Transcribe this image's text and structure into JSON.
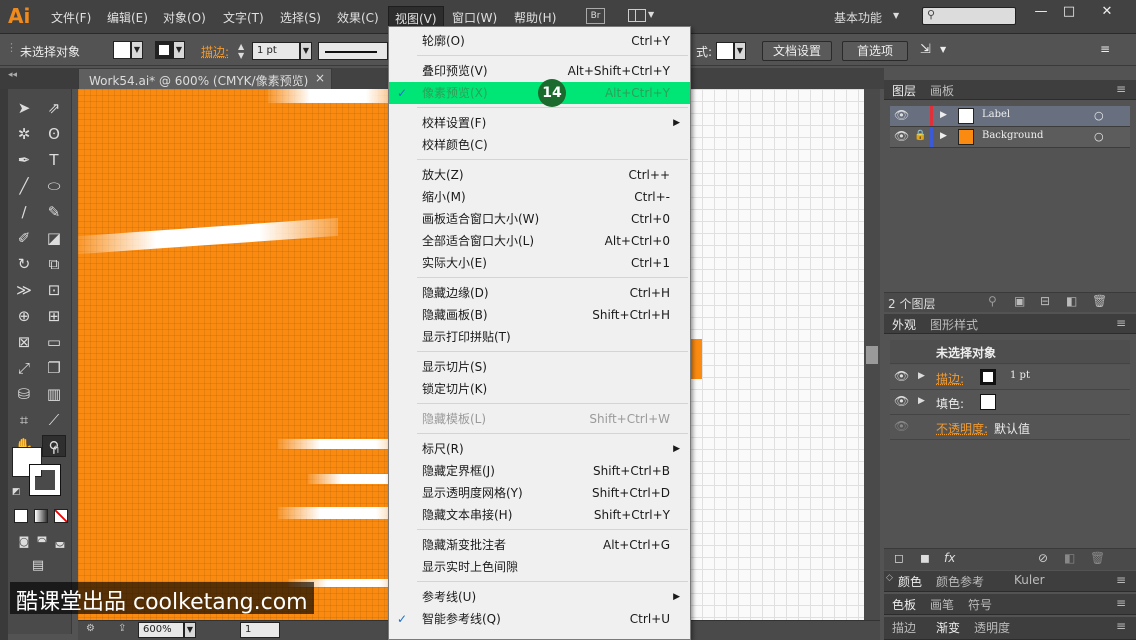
{
  "menubar": {
    "items": [
      "文件(F)",
      "编辑(E)",
      "对象(O)",
      "文字(T)",
      "选择(S)",
      "效果(C)",
      "视图(V)",
      "窗口(W)",
      "帮助(H)"
    ],
    "active_item": "视图(V)",
    "bridge_label": "Br",
    "workspace": "基本功能",
    "search_placeholder": ""
  },
  "control_bar": {
    "selection_status": "未选择对象",
    "stroke_label": "描边:",
    "stroke_weight": "1 pt",
    "style_label": "式:",
    "document_setup_button": "文档设置",
    "preferences_button": "首选项"
  },
  "document_tab": {
    "title": "Work54.ai* @ 600% (CMYK/像素预览)",
    "close": "×"
  },
  "view_menu": {
    "groups": [
      [
        {
          "label": "轮廓(O)",
          "shortcut": "Ctrl+Y"
        }
      ],
      [
        {
          "label": "叠印预览(V)",
          "shortcut": "Alt+Shift+Ctrl+Y"
        },
        {
          "label": "像素预览(X)",
          "shortcut": "Alt+Ctrl+Y",
          "checked": true,
          "highlighted": true
        }
      ],
      [
        {
          "label": "校样设置(F)",
          "submenu": true
        },
        {
          "label": "校样颜色(C)"
        }
      ],
      [
        {
          "label": "放大(Z)",
          "shortcut": "Ctrl++"
        },
        {
          "label": "缩小(M)",
          "shortcut": "Ctrl+-"
        },
        {
          "label": "画板适合窗口大小(W)",
          "shortcut": "Ctrl+0"
        },
        {
          "label": "全部适合窗口大小(L)",
          "shortcut": "Alt+Ctrl+0"
        },
        {
          "label": "实际大小(E)",
          "shortcut": "Ctrl+1"
        }
      ],
      [
        {
          "label": "隐藏边缘(D)",
          "shortcut": "Ctrl+H"
        },
        {
          "label": "隐藏画板(B)",
          "shortcut": "Shift+Ctrl+H"
        },
        {
          "label": "显示打印拼贴(T)"
        }
      ],
      [
        {
          "label": "显示切片(S)"
        },
        {
          "label": "锁定切片(K)"
        }
      ],
      [
        {
          "label": "隐藏模板(L)",
          "shortcut": "Shift+Ctrl+W",
          "disabled": true
        }
      ],
      [
        {
          "label": "标尺(R)",
          "submenu": true
        },
        {
          "label": "隐藏定界框(J)",
          "shortcut": "Shift+Ctrl+B"
        },
        {
          "label": "显示透明度网格(Y)",
          "shortcut": "Shift+Ctrl+D"
        },
        {
          "label": "隐藏文本串接(H)",
          "shortcut": "Shift+Ctrl+Y"
        }
      ],
      [
        {
          "label": "隐藏渐变批注者",
          "shortcut": "Alt+Ctrl+G"
        },
        {
          "label": "显示实时上色间隙"
        }
      ],
      [
        {
          "label": "参考线(U)",
          "submenu": true
        },
        {
          "label": "智能参考线(Q)",
          "shortcut": "Ctrl+U",
          "checked": true
        }
      ]
    ]
  },
  "step_badge": "14",
  "layers_panel": {
    "tabs": [
      "图层",
      "画板"
    ],
    "layers": [
      {
        "name": "Label",
        "color": "#e0303a",
        "selected": true,
        "locked": false
      },
      {
        "name": "Background",
        "color": "#3a5ad8",
        "selected": false,
        "locked": true
      }
    ],
    "count": "2 个图层"
  },
  "appearance_panel": {
    "tabs": [
      "外观",
      "图形样式"
    ],
    "title": "未选择对象",
    "stroke_label": "描边:",
    "stroke_value": "1 pt",
    "fill_label": "填色:",
    "opacity_label": "不透明度:",
    "opacity_value": "默认值"
  },
  "bottom_panels": {
    "color_tabs": [
      "颜色",
      "颜色参考",
      "Kuler"
    ],
    "swatch_tabs": [
      "色板",
      "画笔",
      "符号"
    ],
    "stroke_tabs": [
      "描边",
      "渐变",
      "透明度"
    ]
  },
  "status_bar": {
    "zoom": "600%",
    "artboard": "1"
  },
  "watermark": "酷课堂出品 coolketang.com",
  "colors": {
    "artwork_orange": "#fa8a10",
    "menu_highlight": "#00e676",
    "badge": "#1b6b2e"
  }
}
